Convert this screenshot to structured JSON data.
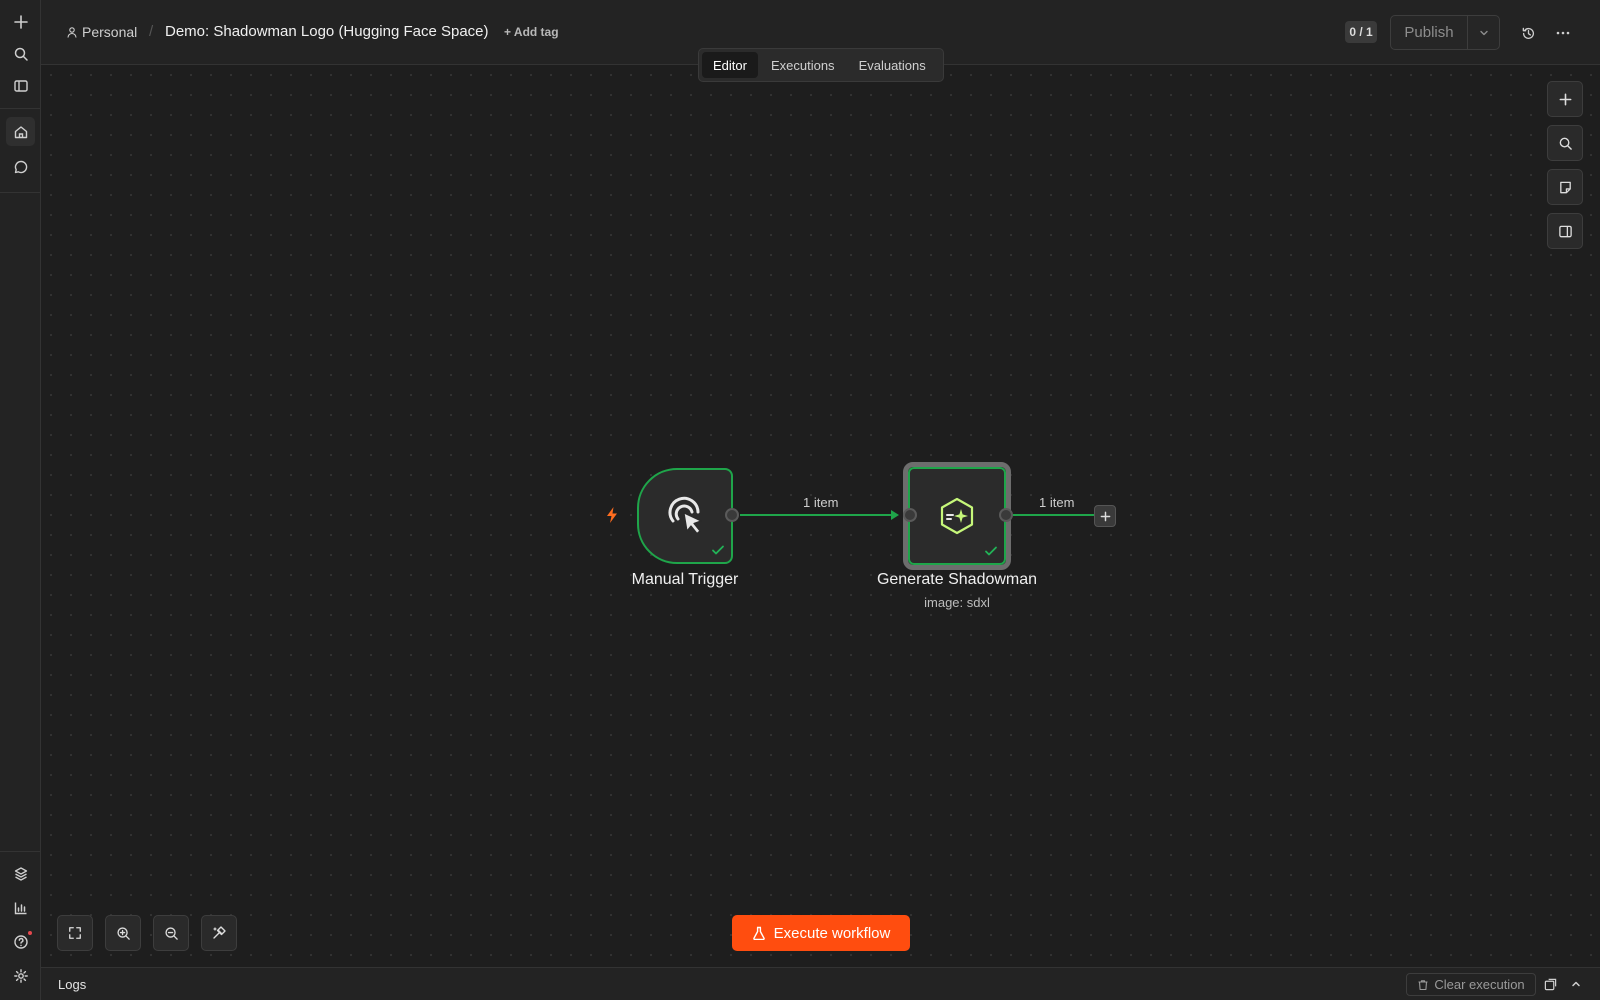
{
  "breadcrumb": {
    "project": "Personal",
    "separator": "/",
    "workflow_title": "Demo: Shadowman Logo (Hugging Face Space)",
    "add_tag": "+ Add tag"
  },
  "header": {
    "counter": "0 / 1",
    "publish_label": "Publish"
  },
  "tabs": [
    {
      "label": "Editor",
      "active": true
    },
    {
      "label": "Executions",
      "active": false
    },
    {
      "label": "Evaluations",
      "active": false
    }
  ],
  "workflow": {
    "nodes": [
      {
        "name": "Manual Trigger",
        "subtitle": "",
        "status": "success",
        "icon": "cursor-click-icon"
      },
      {
        "name": "Generate Shadowman",
        "subtitle": "image: sdxl",
        "status": "success",
        "icon": "ai-hexagon-icon"
      }
    ],
    "connections": [
      {
        "label": "1 item"
      },
      {
        "label": "1 item"
      }
    ]
  },
  "execute_button": "Execute workflow",
  "logs": {
    "title": "Logs",
    "clear_execution": "Clear execution"
  },
  "colors": {
    "accent": "#ff4d0f",
    "success": "#1fa54a",
    "trigger_bolt": "#ff6d1f",
    "background": "#1e1e1e"
  },
  "icons": {
    "rail_top": [
      "plus-icon",
      "search-icon",
      "sidebar-toggle-icon",
      "home-icon",
      "chat-icon"
    ],
    "rail_bottom": [
      "templates-icon",
      "insights-icon",
      "help-icon",
      "settings-icon"
    ],
    "canvas_right": [
      "plus-icon",
      "search-icon",
      "sticky-note-icon",
      "panel-icon"
    ],
    "canvas_zoom": [
      "fit-view-icon",
      "zoom-in-icon",
      "zoom-out-icon",
      "tidy-up-icon"
    ]
  }
}
